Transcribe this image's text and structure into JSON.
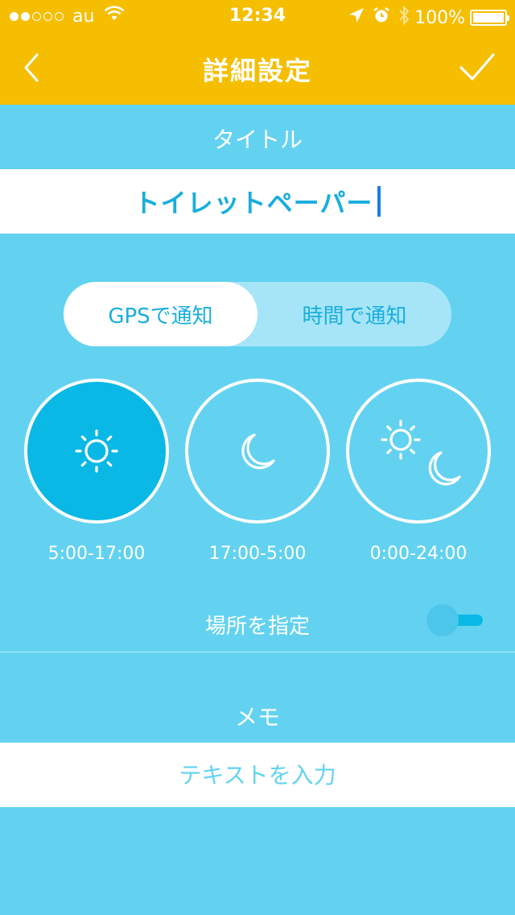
{
  "status_bar": {
    "carrier": "au",
    "time": "12:34",
    "battery": "100%",
    "signal_bars_filled": 2,
    "signal_bars_total": 5
  },
  "nav": {
    "title": "詳細設定",
    "back_icon": "chevron-left-icon",
    "done_icon": "checkmark-icon"
  },
  "title_section": {
    "label": "タイトル",
    "value": "トイレットペーパー"
  },
  "notify_mode": {
    "options": [
      "GPSで通知",
      "時間で通知"
    ],
    "selected": "GPSで通知"
  },
  "time_options": [
    {
      "icon": "sun-icon",
      "label": "5:00-17:00",
      "selected": true
    },
    {
      "icon": "moon-icon",
      "label": "17:00-5:00",
      "selected": false
    },
    {
      "icon": "sun-moon-icon",
      "label": "0:00-24:00",
      "selected": false
    }
  ],
  "location": {
    "label": "場所を指定",
    "toggle_on": false
  },
  "memo": {
    "label": "メモ",
    "placeholder": "テキストを入力"
  },
  "colors": {
    "header": "#f5be00",
    "background": "#63d2f0",
    "accent": "#19aedd",
    "selected_circle": "#09b8e4"
  }
}
